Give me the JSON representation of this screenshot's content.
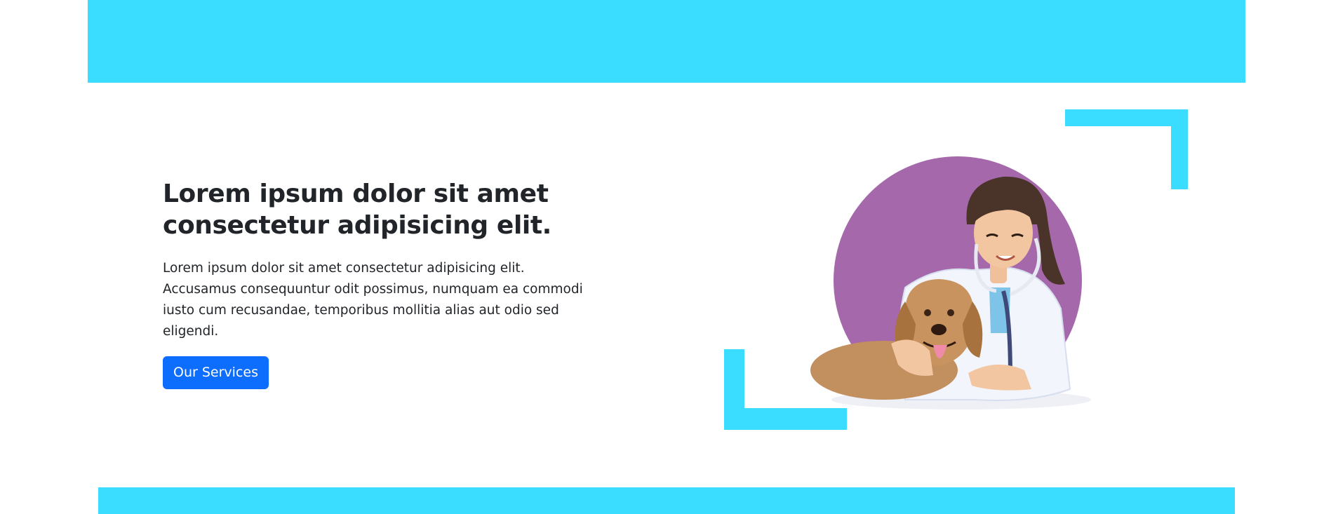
{
  "hero": {
    "title_line1": "Lorem ipsum dolor sit amet",
    "title_line2": "consectetur adipisicing elit.",
    "description": "Lorem ipsum dolor sit amet consectetur adipisicing elit. Accusamus consequuntur odit possimus, numquam ea commodi iusto cum recusandae, temporibus mollitia alias aut odio sed eligendi.",
    "cta_label": "Our Services"
  },
  "colors": {
    "accent": "#3adcff",
    "button": "#0d6efd",
    "circle": "#a569ab",
    "text": "#212529"
  },
  "illustration": {
    "icon": "veterinarian-with-dog-illustration"
  }
}
